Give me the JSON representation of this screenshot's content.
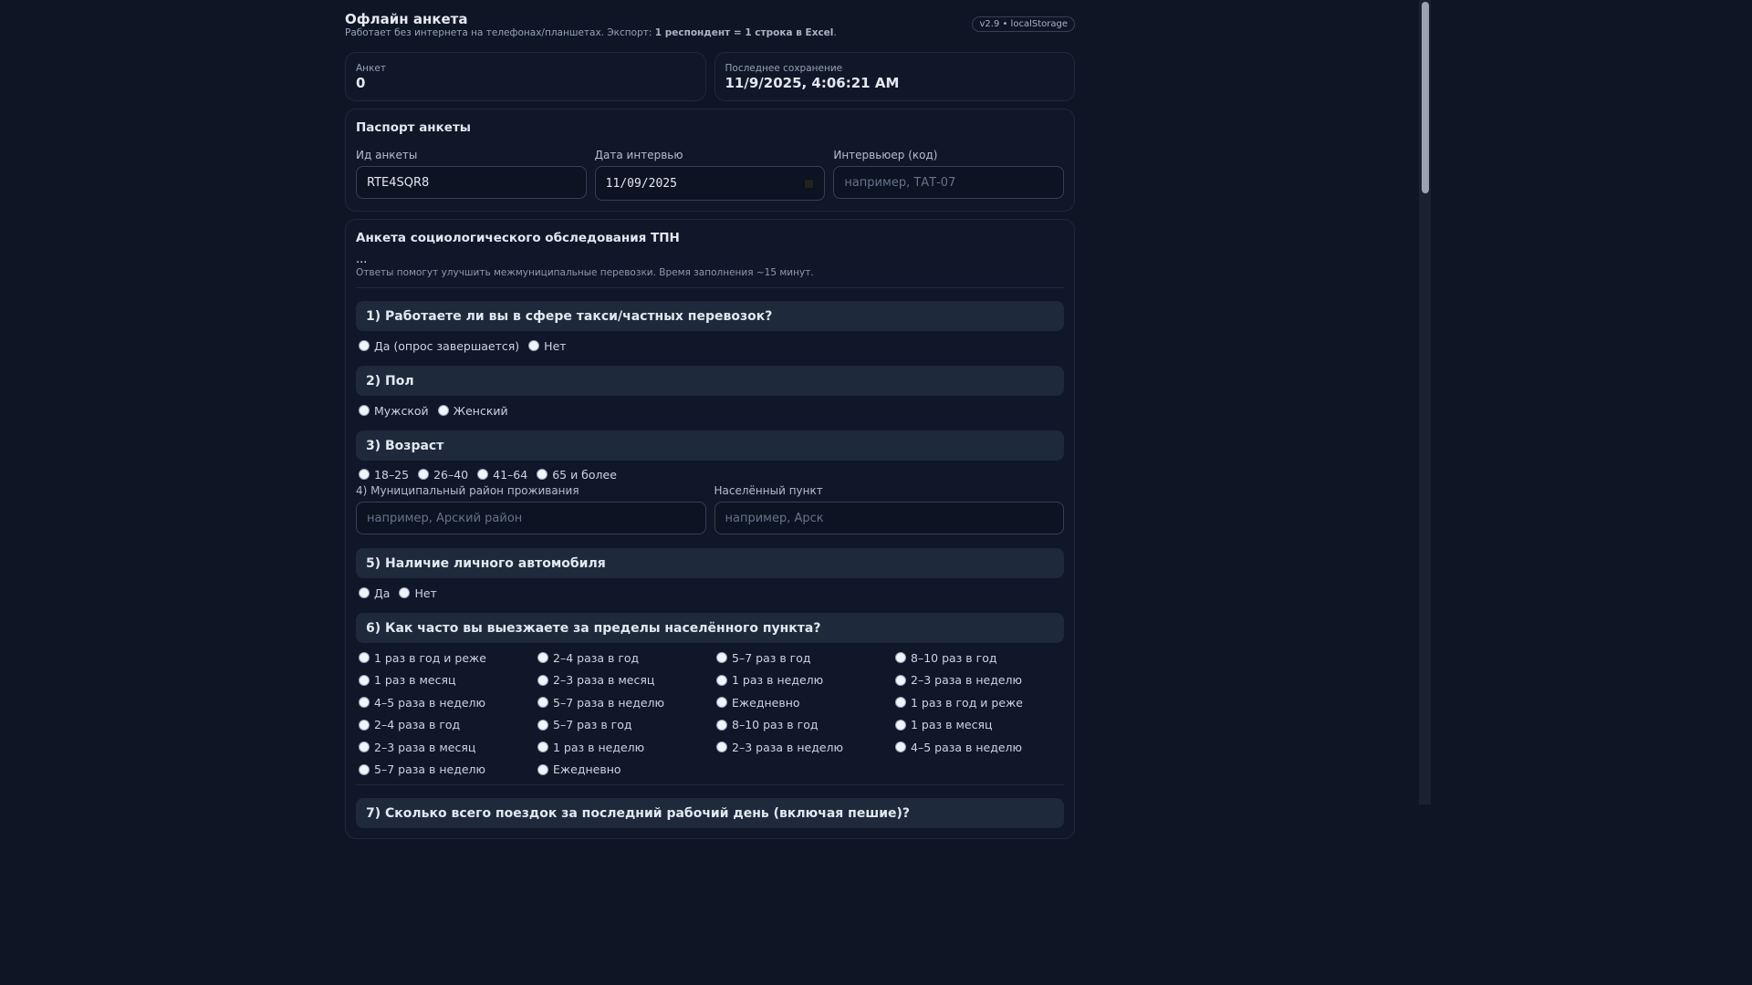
{
  "header": {
    "title": "Офлайн анкета",
    "subtitle_prefix": "Работает без интернета на телефонах/планшетах. Экспорт: ",
    "subtitle_bold": "1 респондент = 1 строка в Excel",
    "subtitle_suffix": ".",
    "badge": "v2.9 • localStorage"
  },
  "stats": {
    "count_label": "Анкет",
    "count_value": "0",
    "saved_label": "Последнее сохранение",
    "saved_value": "11/9/2025, 4:06:21 AM"
  },
  "passport": {
    "title": "Паспорт анкеты",
    "id_label": "Ид анкеты",
    "id_value": "RTE4SQR8",
    "date_label": "Дата интервью",
    "date_value": "11/09/2025",
    "interviewer_label": "Интервьюер (код)",
    "interviewer_placeholder": "например, ТАТ-07"
  },
  "survey": {
    "title": "Анкета социологического обследования ТПН",
    "dots": "...",
    "description": "Ответы помогут улучшить межмуниципальные перевозки. Время заполнения ~15 минут.",
    "q1": {
      "title": "1) Работаете ли вы в сфере такси/частных перевозок?",
      "options": [
        "Да (опрос завершается)",
        "Нет"
      ]
    },
    "q2": {
      "title": "2) Пол",
      "options": [
        "Мужской",
        "Женский"
      ]
    },
    "q3": {
      "title": "3) Возраст",
      "options": [
        "18–25",
        "26–40",
        "41–64",
        "65 и более"
      ]
    },
    "q4": {
      "district_label": "4) Муниципальный район проживания",
      "district_placeholder": "например, Арский район",
      "settlement_label": "Населённый пункт",
      "settlement_placeholder": "например, Арск"
    },
    "q5": {
      "title": "5) Наличие личного автомобиля",
      "options": [
        "Да",
        "Нет"
      ]
    },
    "q6": {
      "title": "6) Как часто вы выезжаете за пределы населённого пункта?",
      "options": [
        "1 раз в год и реже",
        "2–4 раза в год",
        "5–7 раз в год",
        "8–10 раз в год",
        "1 раз в месяц",
        "2–3 раза в месяц",
        "1 раз в неделю",
        "2–3 раза в неделю",
        "4–5 раза в неделю",
        "5–7 раза в неделю",
        "Ежедневно",
        "1 раз в год и реже",
        "2–4 раза в год",
        "5–7 раз в год",
        "8–10 раз в год",
        "1 раз в месяц",
        "2–3 раза в месяц",
        "1 раз в неделю",
        "2–3 раза в неделю",
        "4–5 раза в неделю",
        "5–7 раза в неделю",
        "Ежедневно"
      ]
    },
    "q7": {
      "title": "7) Сколько всего поездок за последний рабочий день (включая пешие)?"
    }
  }
}
